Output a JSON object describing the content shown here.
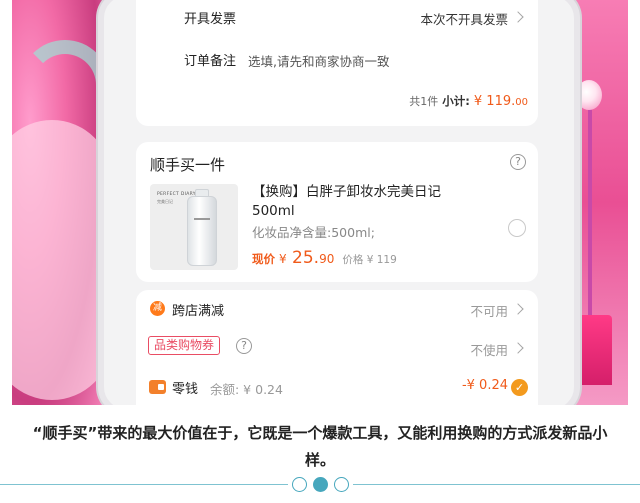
{
  "order": {
    "invoice_label": "开具发票",
    "invoice_value": "本次不开具发票",
    "remark_label": "订单备注",
    "remark_placeholder": "选填,请先和商家协商一致",
    "count_text": "共1件",
    "subtotal_label": "小计:",
    "subtotal_int": "¥ 119.",
    "subtotal_dec": "00"
  },
  "addon": {
    "title": "顺手买一件",
    "help_glyph": "?",
    "product_brand": "PERFECT DIARY",
    "product_brand_cn": "完美日记",
    "product_name": "【换购】白胖子卸妆水完美日记500ml",
    "product_spec": "化妆品净含量:500ml;",
    "now_label": "现价",
    "now_currency": "¥",
    "now_int": "25.",
    "now_dec": "90",
    "orig_price": "价格 ¥ 119"
  },
  "discounts": {
    "cross_store_label": "跨店满减",
    "cross_store_icon": "减",
    "cross_store_value": "不可用",
    "coupon_label": "品类购物券",
    "coupon_value": "不使用",
    "change_label": "零钱",
    "change_balance": "余额: ¥ 0.24",
    "change_deduct": "-¥ 0.24",
    "check_glyph": "✓"
  },
  "caption": {
    "text": "“顺手买”带来的最大价值在于，它既是一个爆款工具，又能利用换购的方式派发新品小样。"
  },
  "colors": {
    "accent_orange": "#f05a1a",
    "coupon_red": "#e94d64",
    "pager_teal": "#47a7bd"
  },
  "pager": {
    "active_index": 2,
    "total": 3
  }
}
